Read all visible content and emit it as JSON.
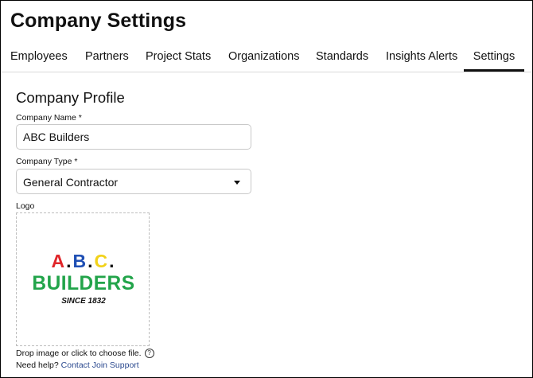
{
  "page": {
    "title": "Company Settings"
  },
  "tabs": [
    {
      "label": "Employees",
      "active": false
    },
    {
      "label": "Partners",
      "active": false
    },
    {
      "label": "Project Stats",
      "active": false
    },
    {
      "label": "Organizations",
      "active": false
    },
    {
      "label": "Standards",
      "active": false
    },
    {
      "label": "Insights Alerts",
      "active": false
    },
    {
      "label": "Settings",
      "active": true
    }
  ],
  "profile": {
    "section_title": "Company Profile",
    "company_name_label": "Company Name *",
    "company_name_value": "ABC Builders",
    "company_type_label": "Company Type *",
    "company_type_value": "General Contractor",
    "logo_label": "Logo",
    "logo": {
      "line1_letters": [
        "A",
        ".",
        "B",
        ".",
        "C",
        "."
      ],
      "line1_colors": [
        "#e0262a",
        "#111111",
        "#1f4fb4",
        "#111111",
        "#f2d21a",
        "#111111"
      ],
      "line2": "BUILDERS",
      "line3": "SINCE 1832"
    },
    "drop_hint": "Drop image or click to choose file.",
    "help_text": "Need help?",
    "support_link": "Contact Join Support"
  },
  "colors": {
    "tab_active_underline": "#111111",
    "logo_green": "#22a44a",
    "link": "#2c4a8f"
  },
  "icons": {
    "dropdown": "caret-down-icon",
    "help": "help-circle-icon"
  }
}
